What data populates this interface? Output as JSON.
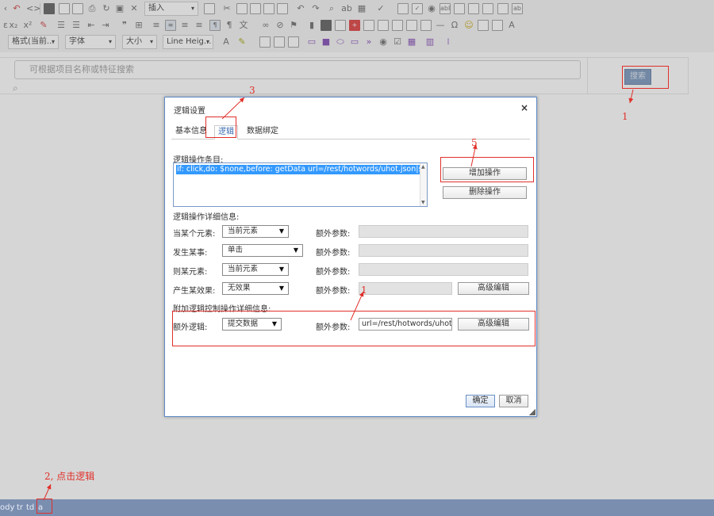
{
  "toolbar": {
    "row3": {
      "format_select": "格式(当前...",
      "font_select": "字体",
      "size_select": "大小",
      "line_height_select": "Line Heig...",
      "insert_select": "插入"
    }
  },
  "page": {
    "search_placeholder": "可根据项目名称或特征搜索",
    "search_button": "搜索"
  },
  "dialog": {
    "title": "逻辑设置",
    "close": "×",
    "tabs": [
      {
        "label": "基本信息",
        "active": false
      },
      {
        "label": "逻辑",
        "active": true
      },
      {
        "label": "数据绑定",
        "active": false
      }
    ],
    "list_label": "逻辑操作条目:",
    "list_item": "if: click,do: $none,before: getData url=/rest/hotwords/uhot.json|sourceEle=#s",
    "add_button": "增加操作",
    "delete_button": "删除操作",
    "detail_label": "逻辑操作详细信息:",
    "rows": [
      {
        "label": "当某个元素:",
        "value": "当前元素",
        "extra_label": "额外参数:"
      },
      {
        "label": "发生某事:",
        "value": "单击",
        "extra_label": "额外参数:"
      },
      {
        "label": "则某元素:",
        "value": "当前元素",
        "extra_label": "额外参数:"
      },
      {
        "label": "产生某效果:",
        "value": "无效果",
        "extra_label": "额外参数:",
        "advanced": "高级编辑"
      }
    ],
    "extra_section_label": "附加逻辑控制操作详细信息:",
    "extra_logic_label": "额外逻辑:",
    "extra_logic_value": "提交数据",
    "extra_param_label": "额外参数:",
    "extra_param_value": "url=/rest/hotwords/uhot.json",
    "extra_advanced": "高级编辑",
    "ok_button": "确定",
    "cancel_button": "取消"
  },
  "statusbar": {
    "items": [
      "ody",
      "tr",
      "td",
      "a"
    ]
  },
  "annotations": {
    "n1_top": "1",
    "n1_mid": "1",
    "n2": "2, 点击逻辑",
    "n3": "3",
    "n5": "5"
  },
  "colors": {
    "annotation_red": "#e0302a",
    "dialog_border": "#5e8bc8",
    "statusbar": "#7a8eb0",
    "selection": "#3399ff"
  }
}
